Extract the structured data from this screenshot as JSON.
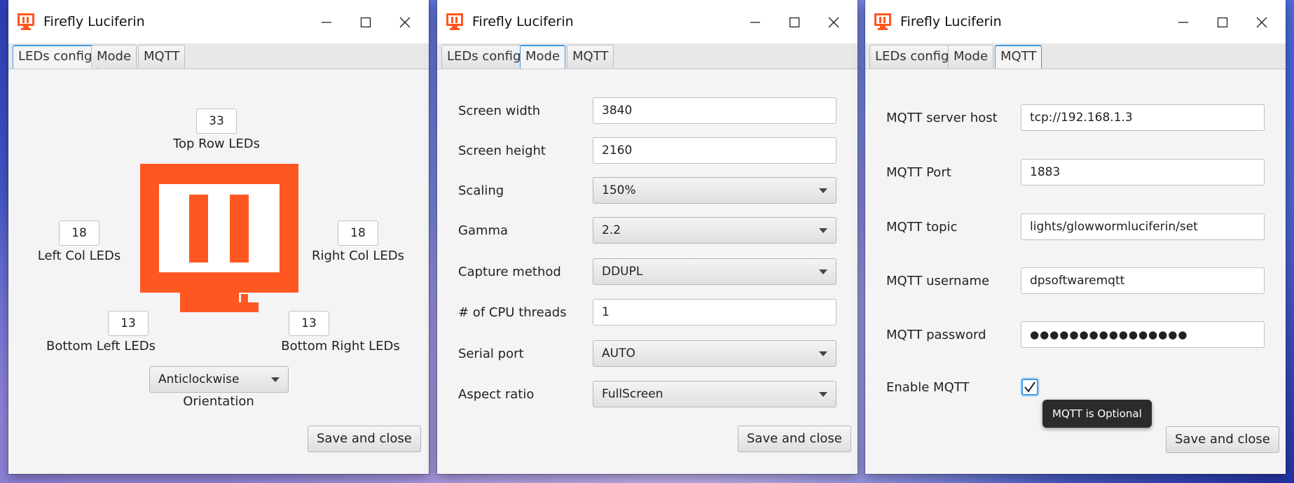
{
  "app": {
    "title": "Firefly Luciferin",
    "accent_color": "#ff5722",
    "logo_icon": "monitor-icon"
  },
  "tabs": [
    "LEDs config",
    "Mode",
    "MQTT"
  ],
  "leds_config": {
    "top_value": "33",
    "top_label": "Top Row LEDs",
    "left_value": "18",
    "left_label": "Left Col LEDs",
    "right_value": "18",
    "right_label": "Right Col LEDs",
    "bottom_left_value": "13",
    "bottom_left_label": "Bottom Left LEDs",
    "bottom_right_value": "13",
    "bottom_right_label": "Bottom Right LEDs",
    "orientation_value": "Anticlockwise",
    "orientation_label": "Orientation",
    "save_label": "Save and close"
  },
  "mode": {
    "screen_width_label": "Screen width",
    "screen_width_value": "3840",
    "screen_height_label": "Screen height",
    "screen_height_value": "2160",
    "scaling_label": "Scaling",
    "scaling_value": "150%",
    "gamma_label": "Gamma",
    "gamma_value": "2.2",
    "capture_label": "Capture method",
    "capture_value": "DDUPL",
    "threads_label": "# of CPU threads",
    "threads_value": "1",
    "serial_label": "Serial port",
    "serial_value": "AUTO",
    "aspect_label": "Aspect ratio",
    "aspect_value": "FullScreen",
    "save_label": "Save and close"
  },
  "mqtt": {
    "host_label": "MQTT server host",
    "host_value": "tcp://192.168.1.3",
    "port_label": "MQTT Port",
    "port_value": "1883",
    "topic_label": "MQTT topic",
    "topic_value": "lights/glowwormluciferin/set",
    "username_label": "MQTT username",
    "username_value": "dpsoftwaremqtt",
    "password_label": "MQTT password",
    "password_value": "●●●●●●●●●●●●●●●●",
    "enable_label": "Enable MQTT",
    "enable_checked": true,
    "tooltip": "MQTT is Optional",
    "save_label": "Save and close"
  }
}
